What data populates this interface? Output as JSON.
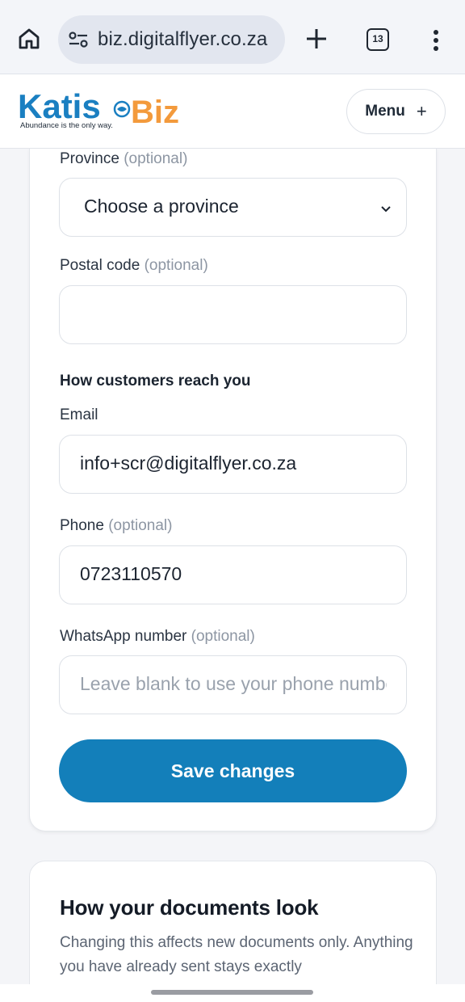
{
  "browser": {
    "url": "biz.digitalflyer.co.za",
    "tab_count": "13",
    "icons": [
      "home-icon",
      "site-settings-icon",
      "new-tab-icon",
      "tab-switcher-icon",
      "more-options-icon"
    ]
  },
  "header": {
    "logo_text_primary": "Katis",
    "logo_text_secondary": "Biz",
    "logo_tagline": "Abundance is the only way.",
    "menu_label": "Menu",
    "menu_icon": "+"
  },
  "form": {
    "province": {
      "label": "Province",
      "optional": "(optional)",
      "value": "Choose a province"
    },
    "postal_code": {
      "label": "Postal code",
      "optional": "(optional)",
      "value": ""
    },
    "contact_heading": "How customers reach you",
    "email": {
      "label": "Email",
      "value": "info+scr@digitalflyer.co.za"
    },
    "phone": {
      "label": "Phone",
      "optional": "(optional)",
      "value": "0723110570"
    },
    "whatsapp": {
      "label": "WhatsApp number",
      "optional": "(optional)",
      "placeholder": "Leave blank to use your phone number"
    },
    "save_label": "Save changes"
  },
  "documents": {
    "title": "How your documents look",
    "body": "Changing this affects new documents only. Anything you have already sent stays exactly"
  },
  "colors": {
    "primary": "#137fba",
    "logo_blue": "#1a7fc1",
    "logo_orange": "#f39a3c"
  }
}
